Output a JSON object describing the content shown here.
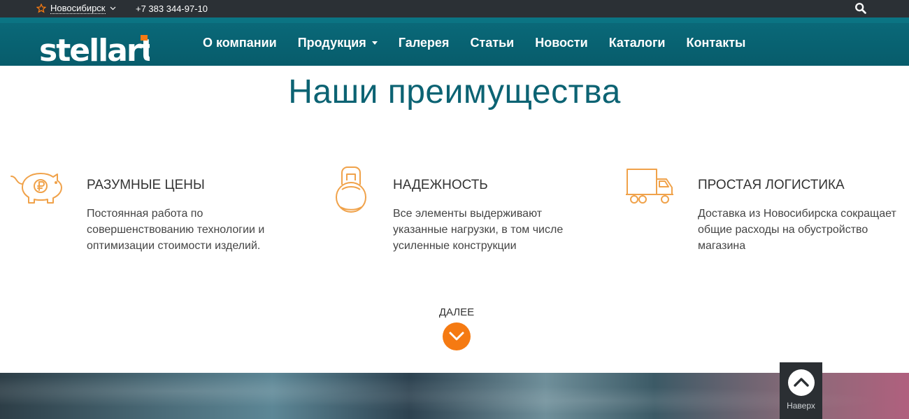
{
  "topbar": {
    "city": "Новосибирск",
    "phone": "+7 383 344-97-10",
    "icons": {
      "city": "star-icon",
      "search": "search-icon"
    }
  },
  "logo": {
    "text": "stellart"
  },
  "nav": {
    "items": [
      {
        "label": "О компании"
      },
      {
        "label": "Продукция",
        "has_dropdown": true
      },
      {
        "label": "Галерея"
      },
      {
        "label": "Статьи"
      },
      {
        "label": "Новости"
      },
      {
        "label": "Каталоги"
      },
      {
        "label": "Контакты"
      }
    ]
  },
  "advantages": {
    "title": "Наши преимущества",
    "items": [
      {
        "icon": "piggy-bank-ruble-icon",
        "title": "РАЗУМНЫЕ ЦЕНЫ",
        "text": "Постоянная работа по совершенствованию технологии и оптимизации стоимости изделий."
      },
      {
        "icon": "kettlebell-icon",
        "title": "НАДЕЖНОСТЬ",
        "text": "Все элементы выдерживают указанные нагрузки, в том числе усиленные конструкции"
      },
      {
        "icon": "delivery-truck-icon",
        "title": "ПРОСТАЯ ЛОГИСТИКА",
        "text": "Доставка из Новосибирска сокращает общие расходы на обустройство магазина"
      }
    ],
    "more_label": "ДАЛЕЕ"
  },
  "scroll_top": {
    "label": "Наверх"
  },
  "colors": {
    "topbar": "#2b3035",
    "nav": "#075c6b",
    "title": "#0c6373",
    "accent": "#f57a12",
    "icon_line": "#f0a24a"
  }
}
